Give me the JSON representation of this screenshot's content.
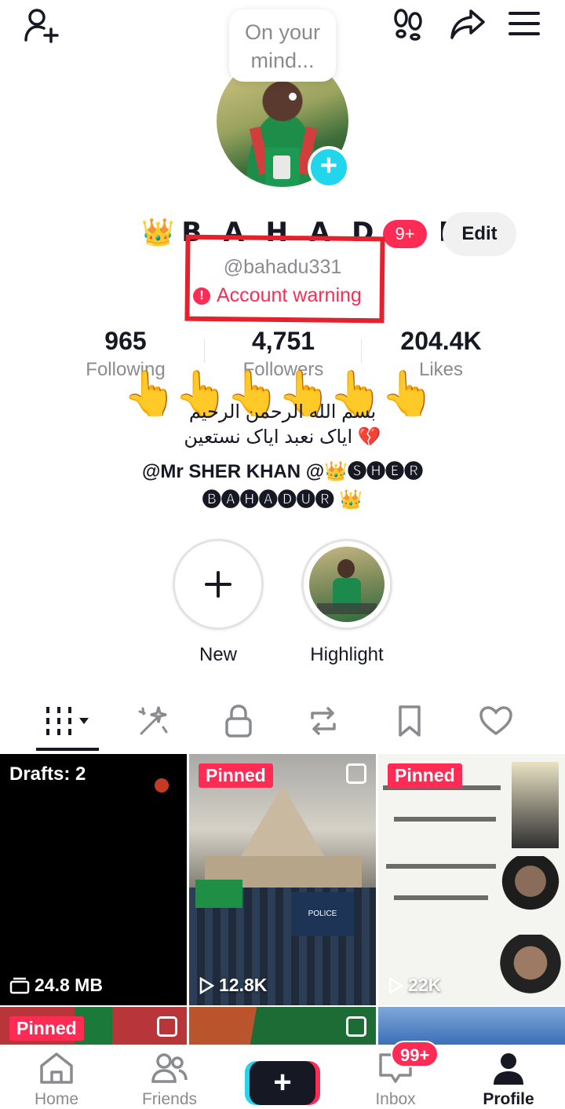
{
  "bubble": {
    "text_line1": "On your",
    "text_line2": "mind..."
  },
  "profile": {
    "display_name": "👑𝗕 𝗔 𝗛 𝗔 𝗗 𝗨 𝗥👑",
    "name_badge": "9+",
    "edit_label": "Edit",
    "username": "@bahadu331",
    "warning": "Account warning"
  },
  "stats": [
    {
      "value": "965",
      "label": "Following"
    },
    {
      "value": "4,751",
      "label": "Followers"
    },
    {
      "value": "204.4K",
      "label": "Likes"
    }
  ],
  "bio": {
    "hands": "👆👆👆👆👆👆",
    "line1": "بسم الله الرحمن الرحیم",
    "line2": "ایاک نعبد ایاک نستعین 💔",
    "line3": "@Mr SHER KHAN @👑🅢🅗🅔🅡",
    "line4": "🅑🅐🅗🅐🅓🅤🅡 👑"
  },
  "highlights": [
    {
      "label": "New",
      "icon": "plus-icon"
    },
    {
      "label": "Highlight",
      "icon": "thumbnail"
    }
  ],
  "tabs": [
    "grid-icon",
    "sparkle-icon",
    "lock-icon",
    "repost-icon",
    "bookmark-icon",
    "heart-icon"
  ],
  "grid": [
    {
      "overlay": "Drafts: 2",
      "stat": "24.8 MB"
    },
    {
      "overlay": "Pinned",
      "stat": "12.8K"
    },
    {
      "overlay": "Pinned",
      "stat": "22K"
    },
    {
      "overlay": "Pinned",
      "stat": ""
    }
  ],
  "nav": {
    "home": "Home",
    "friends": "Friends",
    "inbox": "Inbox",
    "inbox_badge": "99+",
    "profile": "Profile"
  },
  "colors": {
    "accent": "#fe2c55",
    "cyan": "#20d5ec",
    "text": "#161823",
    "muted": "#8a8b91"
  }
}
